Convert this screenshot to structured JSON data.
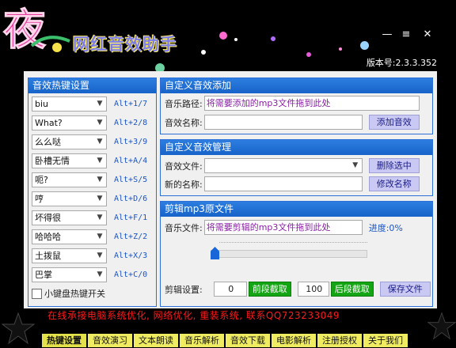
{
  "app": {
    "title": "网红音效助手",
    "version": "版本号:2.3.3.352",
    "logo_char": "夜"
  },
  "window_controls": {
    "minimize": "—",
    "menu": "≡",
    "close": "✕"
  },
  "hotkeys": {
    "title": "音效热键设置",
    "items": [
      {
        "sound": "biu",
        "key": "Alt+1/7"
      },
      {
        "sound": "What?",
        "key": "Alt+2/8"
      },
      {
        "sound": "么么哒",
        "key": "Alt+3/9"
      },
      {
        "sound": "卧槽无情",
        "key": "Alt+A/4"
      },
      {
        "sound": "呃?",
        "key": "Alt+S/5"
      },
      {
        "sound": "哼",
        "key": "Alt+D/6"
      },
      {
        "sound": "坏得很",
        "key": "Alt+F/1"
      },
      {
        "sound": "哈哈哈",
        "key": "Alt+Z/2"
      },
      {
        "sound": "土拨鼠",
        "key": "Alt+X/3"
      },
      {
        "sound": "巴掌",
        "key": "Alt+C/0"
      }
    ],
    "checkbox_label": "小键盘热键开关"
  },
  "add_sound": {
    "title": "自定义音效添加",
    "path_label": "音乐路径:",
    "path_value": "将需要添加的mp3文件拖到此处",
    "name_label": "音效名称:",
    "name_value": "",
    "add_button": "添加音效"
  },
  "manage_sound": {
    "title": "自定义音效管理",
    "file_label": "音效文件:",
    "file_value": "",
    "delete_button": "删除选中",
    "newname_label": "新的名称:",
    "newname_value": "",
    "rename_button": "修改名称"
  },
  "cut_mp3": {
    "title": "剪辑mp3原文件",
    "file_label": "音乐文件:",
    "file_value": "将需要剪辑的mp3文件拖到此处",
    "progress_label": "进度:0%",
    "progress_percent": 0,
    "settings_label": "剪辑设置:",
    "start_value": "0",
    "start_button": "前段截取",
    "end_value": "100",
    "end_button": "后段截取",
    "save_button": "保存文件"
  },
  "marquee": "在线承接电脑系统优化, 网络优化, 重装系统, 联系QQ723233049",
  "tabs": [
    "热键设置",
    "音效演习",
    "文本朗读",
    "音乐解析",
    "音效下载",
    "电影解析",
    "注册授权",
    "关于我们"
  ],
  "colors": {
    "panel_header": "#1f6fd6",
    "hotkey_text": "#1a55c6",
    "drop_hint": "#8b1fa8",
    "button": "#c9c9f3",
    "green_button": "#14a514",
    "marquee": "#ff1a1a",
    "tab": "#efec62"
  }
}
